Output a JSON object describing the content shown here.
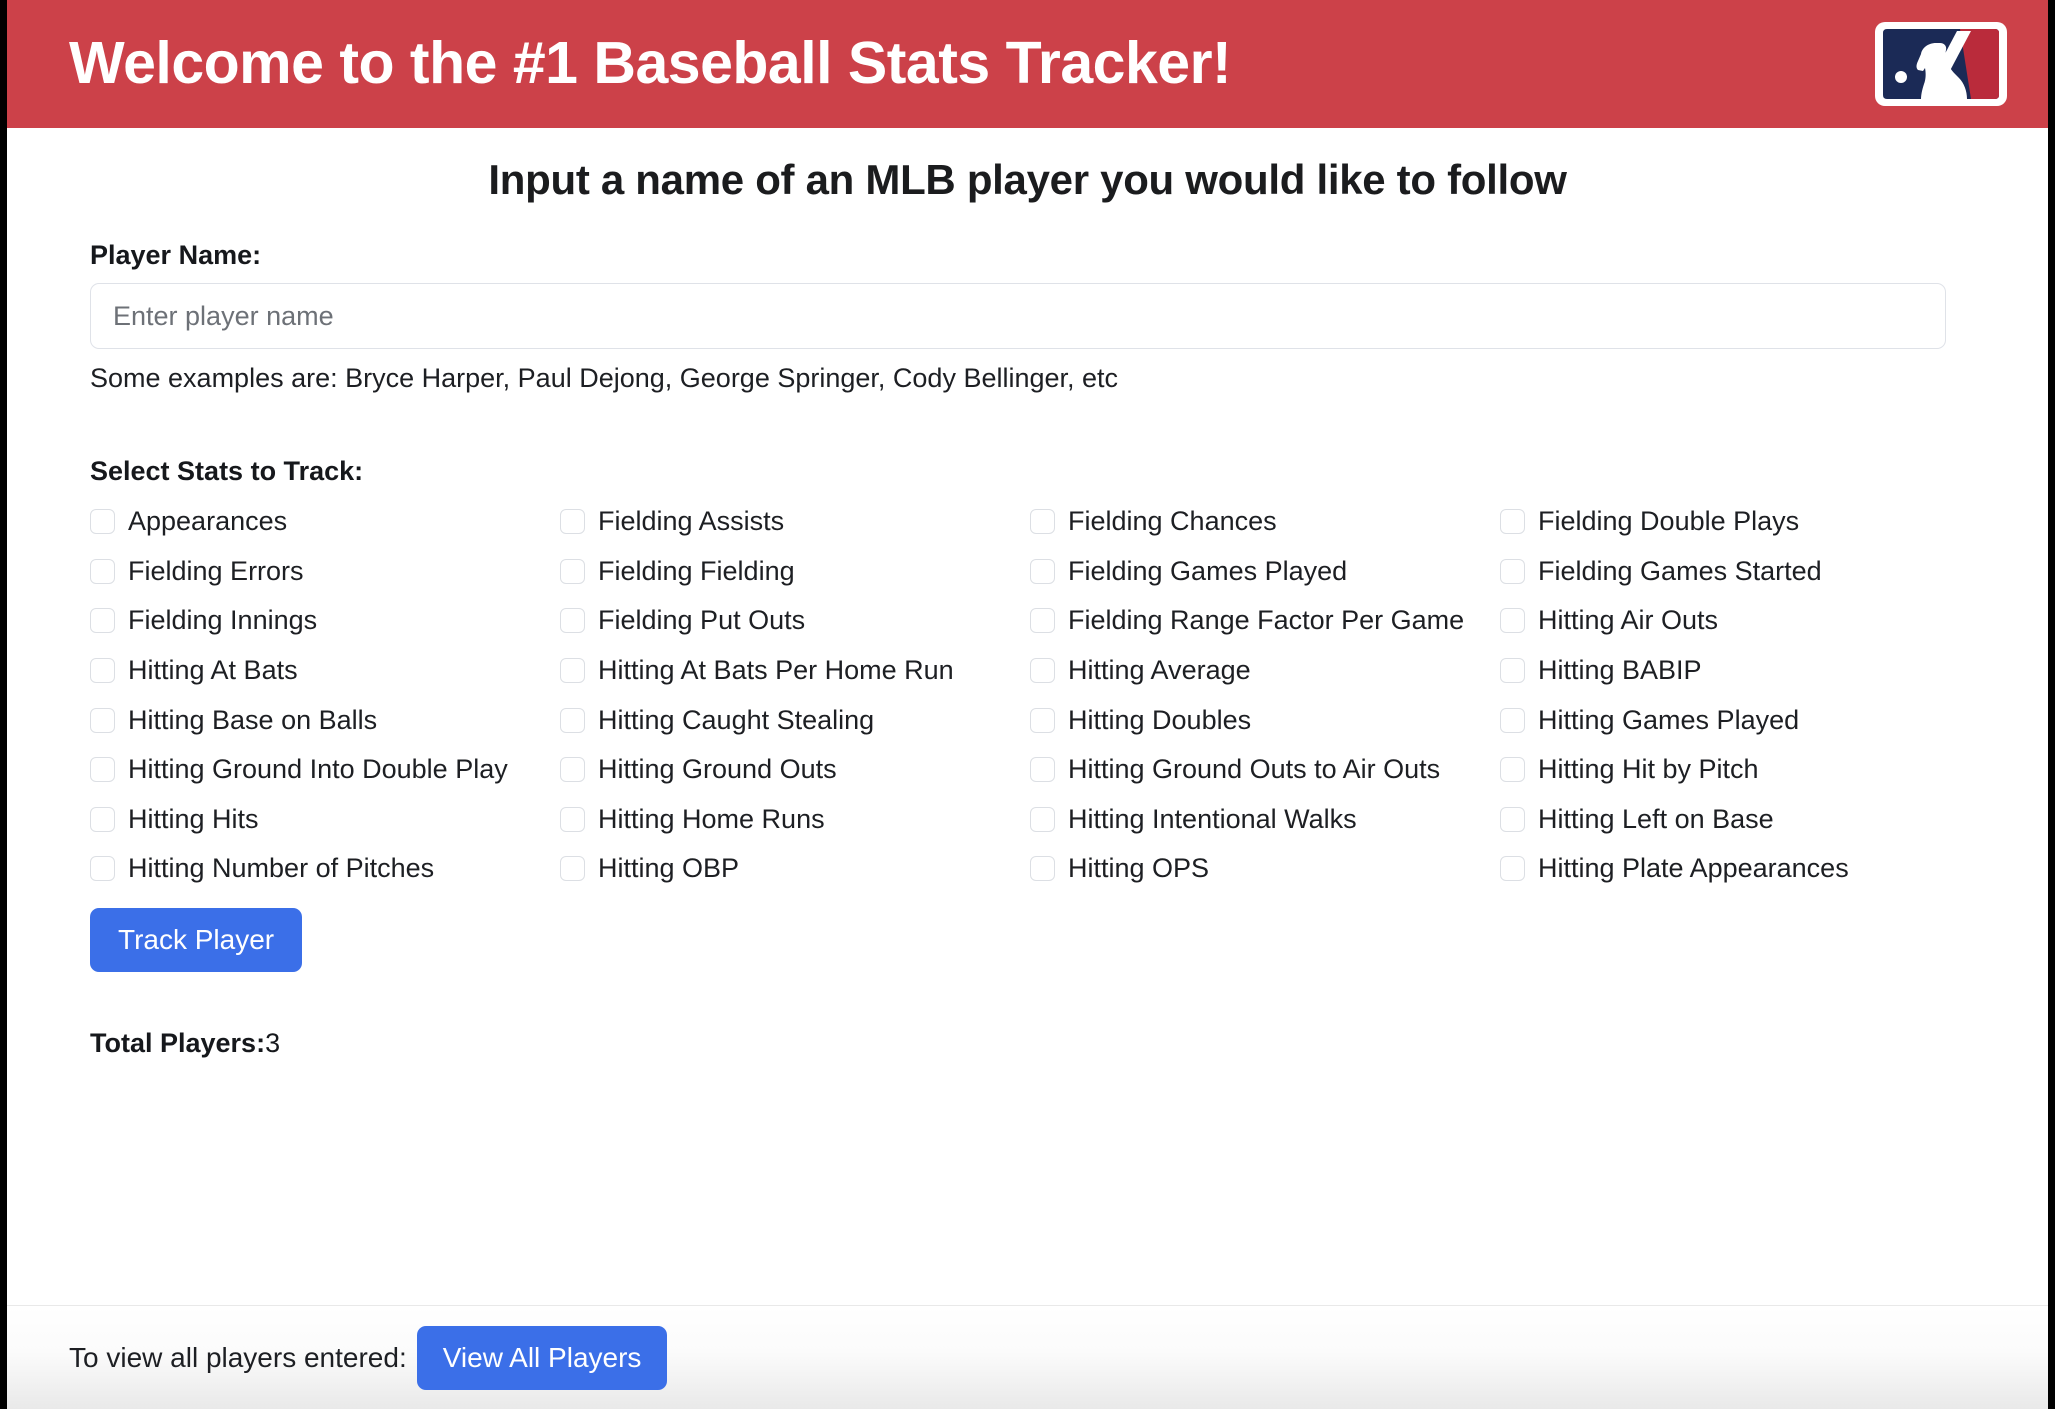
{
  "header": {
    "title": "Welcome to the #1 Baseball Stats Tracker!",
    "logo_name": "mlb-logo",
    "bg_color": "#cc4149"
  },
  "subtitle": "Input a name of an MLB player you would like to follow",
  "form": {
    "player_name_label": "Player Name:",
    "player_name_value": "",
    "player_name_placeholder": "Enter player name",
    "examples_text": "Some examples are: Bryce Harper, Paul Dejong, George Springer, Cody Bellinger, etc"
  },
  "stats": {
    "heading": "Select Stats to Track:",
    "items": [
      {
        "label": "Appearances",
        "checked": false
      },
      {
        "label": "Fielding Assists",
        "checked": false
      },
      {
        "label": "Fielding Chances",
        "checked": false
      },
      {
        "label": "Fielding Double Plays",
        "checked": false
      },
      {
        "label": "Fielding Errors",
        "checked": false
      },
      {
        "label": "Fielding Fielding",
        "checked": false
      },
      {
        "label": "Fielding Games Played",
        "checked": false
      },
      {
        "label": "Fielding Games Started",
        "checked": false
      },
      {
        "label": "Fielding Innings",
        "checked": false
      },
      {
        "label": "Fielding Put Outs",
        "checked": false
      },
      {
        "label": "Fielding Range Factor Per Game",
        "checked": false
      },
      {
        "label": "Hitting Air Outs",
        "checked": false
      },
      {
        "label": "Hitting At Bats",
        "checked": false
      },
      {
        "label": "Hitting At Bats Per Home Run",
        "checked": false
      },
      {
        "label": "Hitting Average",
        "checked": false
      },
      {
        "label": "Hitting BABIP",
        "checked": false
      },
      {
        "label": "Hitting Base on Balls",
        "checked": false
      },
      {
        "label": "Hitting Caught Stealing",
        "checked": false
      },
      {
        "label": "Hitting Doubles",
        "checked": false
      },
      {
        "label": "Hitting Games Played",
        "checked": false
      },
      {
        "label": "Hitting Ground Into Double Play",
        "checked": false
      },
      {
        "label": "Hitting Ground Outs",
        "checked": false
      },
      {
        "label": "Hitting Ground Outs to Air Outs",
        "checked": false
      },
      {
        "label": "Hitting Hit by Pitch",
        "checked": false
      },
      {
        "label": "Hitting Hits",
        "checked": false
      },
      {
        "label": "Hitting Home Runs",
        "checked": false
      },
      {
        "label": "Hitting Intentional Walks",
        "checked": false
      },
      {
        "label": "Hitting Left on Base",
        "checked": false
      },
      {
        "label": "Hitting Number of Pitches",
        "checked": false
      },
      {
        "label": "Hitting OBP",
        "checked": false
      },
      {
        "label": "Hitting OPS",
        "checked": false
      },
      {
        "label": "Hitting Plate Appearances",
        "checked": false
      }
    ]
  },
  "track_button_label": "Track Player",
  "total_players": {
    "label": "Total Players:",
    "value": "3"
  },
  "footer": {
    "text": "To view all players entered:",
    "button_label": "View All Players"
  },
  "colors": {
    "accent_red": "#cc4149",
    "accent_blue": "#3b6fe8",
    "logo_navy": "#1b2a56",
    "logo_red": "#ba2b3b"
  }
}
